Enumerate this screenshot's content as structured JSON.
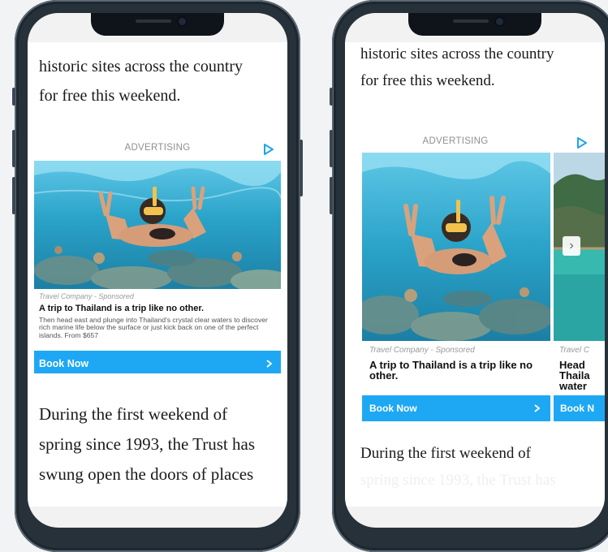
{
  "article": {
    "intro_line1": "historic sites across the country",
    "intro_line2": "for free this weekend.",
    "body_line1": "During the first weekend of",
    "body_line2": "spring since 1993, the Trust has",
    "body_line3": "swung open the doors of places"
  },
  "ad": {
    "label": "ADVERTISING",
    "choices_icon": "ad-choices-play-icon",
    "sponsor": "Travel Company - Sponsored",
    "sponsor_partial": "Travel C",
    "headline": "A trip to Thailand is a trip like no other.",
    "body": "Then head east and plunge into Thailand's crystal clear waters to discover rich marine life below the surface or just kick back on one of the perfect islands. From $657",
    "cta_label": "Book Now",
    "cta_label_partial": "Book N",
    "cta_icon": "chevron-right-icon",
    "second_card_text": [
      "Head",
      "Thaila",
      "water"
    ],
    "carousel_arrow": "›"
  },
  "colors": {
    "cta_blue": "#1ea8f4",
    "phone_frame": "#27313a"
  }
}
